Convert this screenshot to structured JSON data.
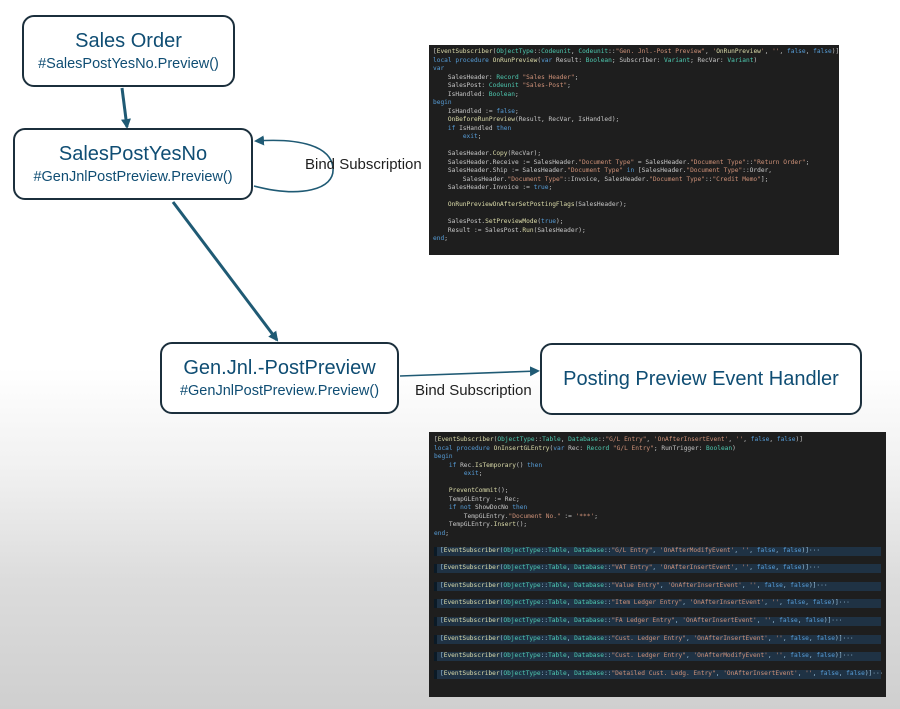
{
  "diagram": {
    "nodes": {
      "sales_order": {
        "title": "Sales Order",
        "subtitle": "#SalesPostYesNo.Preview()"
      },
      "sales_post_yes_no": {
        "title": "SalesPostYesNo",
        "subtitle": "#GenJnlPostPreview.Preview()"
      },
      "gen_jnl_post_preview": {
        "title": "Gen.Jnl.-PostPreview",
        "subtitle": "#GenJnlPostPreview.Preview()"
      },
      "posting_preview_handler": {
        "title": "Posting Preview Event Handler"
      }
    },
    "edge_labels": {
      "bind_subscription_self": "Bind Subscription",
      "bind_subscription_handler": "Bind Subscription"
    },
    "colors": {
      "node_border": "#1b2f3c",
      "node_text": "#0f4d73",
      "arrow": "#1f5a74",
      "code_bg": "#1e1e1e"
    }
  },
  "code_top": {
    "lines": [
      "[EventSubscriber(ObjectType::Codeunit, Codeunit::\"Gen. Jnl.-Post Preview\", 'OnRunPreview', '', false, false)]",
      "local procedure OnRunPreview(var Result: Boolean; Subscriber: Variant; RecVar: Variant)",
      "var",
      "    SalesHeader: Record \"Sales Header\";",
      "    SalesPost: Codeunit \"Sales-Post\";",
      "    IsHandled: Boolean;",
      "begin",
      "    IsHandled := false;",
      "    OnBeforeRunPreview(Result, RecVar, IsHandled);",
      "    if IsHandled then",
      "        exit;",
      "",
      "    SalesHeader.Copy(RecVar);",
      "    SalesHeader.Receive := SalesHeader.\"Document Type\" = SalesHeader.\"Document Type\"::\"Return Order\";",
      "    SalesHeader.Ship := SalesHeader.\"Document Type\" in [SalesHeader.\"Document Type\"::Order,",
      "        SalesHeader.\"Document Type\"::Invoice, SalesHeader.\"Document Type\"::\"Credit Memo\"];",
      "    SalesHeader.Invoice := true;",
      "",
      "    OnRunPreviewOnAfterSetPostingFlags(SalesHeader);",
      "",
      "    SalesPost.SetPreviewMode(true);",
      "    Result := SalesPost.Run(SalesHeader);",
      "end;"
    ]
  },
  "code_bottom": {
    "lines": [
      "[EventSubscriber(ObjectType::Table, Database::\"G/L Entry\", 'OnAfterInsertEvent', '', false, false)]",
      "local procedure OnInsertGLEntry(var Rec: Record \"G/L Entry\"; RunTrigger: Boolean)",
      "begin",
      "    if Rec.IsTemporary() then",
      "        exit;",
      "",
      "    PreventCommit();",
      "    TempGLEntry := Rec;",
      "    if not ShowDocNo then",
      "        TempGLEntry.\"Document No.\" := '***';",
      "    TempGLEntry.Insert();",
      "end;"
    ],
    "collapsed": [
      "[EventSubscriber(ObjectType::Table, Database::\"G/L Entry\", 'OnAfterModifyEvent', '', false, false)]···",
      "[EventSubscriber(ObjectType::Table, Database::\"VAT Entry\", 'OnAfterInsertEvent', '', false, false)]···",
      "[EventSubscriber(ObjectType::Table, Database::\"Value Entry\", 'OnAfterInsertEvent', '', false, false)]···",
      "[EventSubscriber(ObjectType::Table, Database::\"Item Ledger Entry\", 'OnAfterInsertEvent', '', false, false)]···",
      "[EventSubscriber(ObjectType::Table, Database::\"FA Ledger Entry\", 'OnAfterInsertEvent', '', false, false)]···",
      "[EventSubscriber(ObjectType::Table, Database::\"Cust. Ledger Entry\", 'OnAfterInsertEvent', '', false, false)]···",
      "[EventSubscriber(ObjectType::Table, Database::\"Cust. Ledger Entry\", 'OnAfterModifyEvent', '', false, false)]···",
      "[EventSubscriber(ObjectType::Table, Database::\"Detailed Cust. Ledg. Entry\", 'OnAfterInsertEvent', '', false, false)]···"
    ]
  }
}
